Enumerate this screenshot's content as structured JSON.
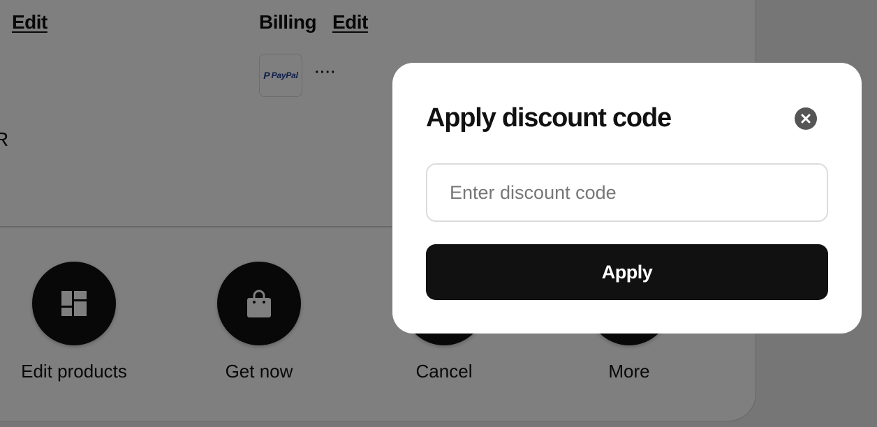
{
  "header": {
    "edit_left": "Edit",
    "billing_label": "Billing",
    "edit_billing": "Edit"
  },
  "billing": {
    "payment_logo_text": "PayPal",
    "payment_logo_p": "P",
    "more_dots": "····"
  },
  "partial_text": "R",
  "actions": [
    {
      "label": "Edit products",
      "icon": "dashboard-icon"
    },
    {
      "label": "Get now",
      "icon": "shopping-bag-icon"
    },
    {
      "label": "Cancel",
      "icon": "cancel-icon"
    },
    {
      "label": "More",
      "icon": "more-icon"
    }
  ],
  "modal": {
    "title": "Apply discount code",
    "close_icon": "close-icon",
    "input_placeholder": "Enter discount code",
    "input_value": "",
    "apply_label": "Apply"
  },
  "colors": {
    "overlay": "rgba(0,0,0,0.5)",
    "primary_button": "#111111",
    "close_button": "#555555"
  }
}
